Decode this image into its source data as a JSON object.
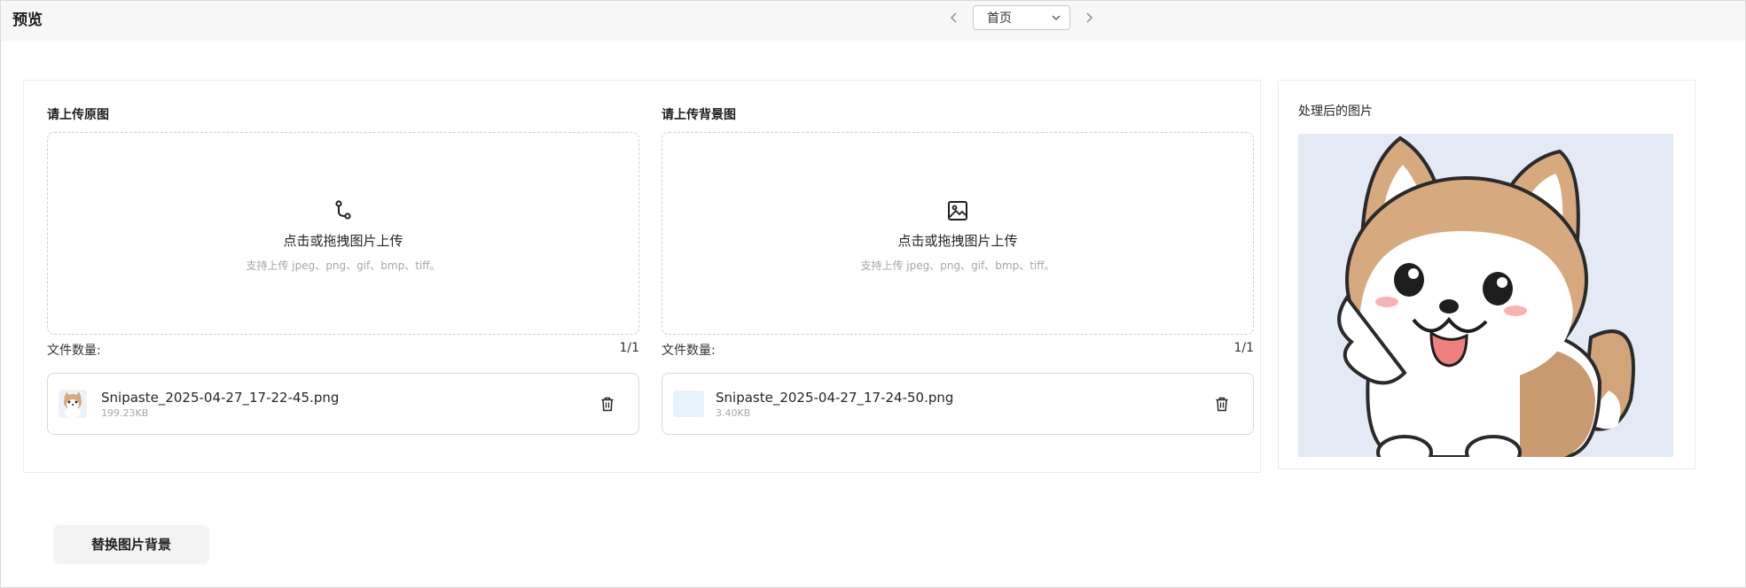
{
  "header": {
    "title": "预览",
    "page_select": {
      "value": "首页"
    },
    "icons": {
      "prev": "chevron-left-icon",
      "next": "chevron-right-icon",
      "dropdown": "chevron-down-icon"
    }
  },
  "upload_original": {
    "title": "请上传原图",
    "icon": "upload-branch-icon",
    "prompt": "点击或拖拽图片上传",
    "hint": "支持上传 jpeg、png、gif、bmp、tiff。",
    "count_label": "文件数量:",
    "count_value": "1/1",
    "file": {
      "name": "Snipaste_2025-04-27_17-22-45.png",
      "size": "199.23KB",
      "thumb_icon": "dog-thumbnail"
    }
  },
  "upload_background": {
    "title": "请上传背景图",
    "icon": "image-icon",
    "prompt": "点击或拖拽图片上传",
    "hint": "支持上传 jpeg、png、gif、bmp、tiff。",
    "count_label": "文件数量:",
    "count_value": "1/1",
    "file": {
      "name": "Snipaste_2025-04-27_17-24-50.png",
      "size": "3.40KB",
      "thumb_color": "#e6f3fc"
    }
  },
  "result": {
    "title": "处理后的图片",
    "background_color": "#e3e9f5"
  },
  "actions": {
    "replace_bg_label": "替换图片背景"
  }
}
